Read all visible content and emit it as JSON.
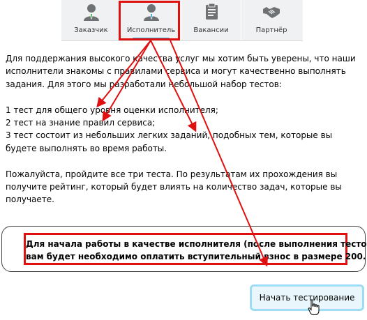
{
  "tabs": [
    {
      "label": "Заказчик",
      "icon": "person-icon",
      "active": false
    },
    {
      "label": "Исполнитель",
      "icon": "person-tie-icon",
      "active": true
    },
    {
      "label": "Вакансии",
      "icon": "clipboard-icon",
      "active": false
    },
    {
      "label": "Партнёр",
      "icon": "handshake-icon",
      "active": false
    }
  ],
  "content": {
    "intro": [
      "Для поддержания высокого качества услуг мы хотим быть уверены, что наши",
      "исполнители знакомы с правилами сервиса и могут качественно выполнять",
      "задания. Для этого мы разработали небольшой набор тестов:"
    ],
    "tests": [
      "1 тест для общего уровня оценки исполнителя;",
      "2 тест на знание правил сервиса;",
      "3 тест состоит из небольших легких заданий, подобных тем, которые вы",
      "будете выполнять во время работы."
    ],
    "outro": [
      "Пожалуйста, пройдите все три теста. По результатам их прохождения вы",
      "получите рейтинг, который будет влиять на количество задач, которые вы",
      "получаете."
    ]
  },
  "notice": {
    "line1": "Для начала работы в качестве исполнителя (после выполнения тестов)",
    "line2": "вам будет необходимо оплатить вступительный взнос в размере 200."
  },
  "start_button": {
    "label": "Начать тестирование"
  },
  "colors": {
    "annotation": "#e01010",
    "accent": "#2aa6d8",
    "tab_background": "#f0f1f2",
    "button_border": "#9fdcf5",
    "button_background": "#e9f6fc",
    "icon": "#6f7275"
  }
}
